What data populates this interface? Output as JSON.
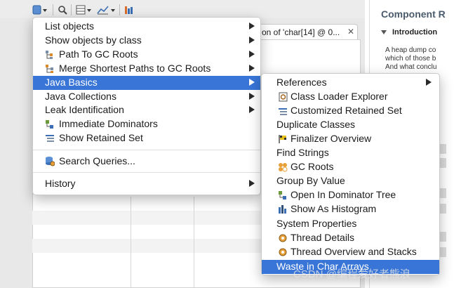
{
  "background": {
    "editor_tab_title": "on of 'char[14] @ 0...",
    "editor_tab_close": "✕",
    "right_panel": {
      "title": "Component R",
      "section_title": "Introduction",
      "text_lines": [
        "A heap dump co",
        "which of those b",
        "And what conclu"
      ]
    }
  },
  "main_menu": {
    "items": [
      {
        "label": "List objects",
        "has_submenu": true
      },
      {
        "label": "Show objects by class",
        "has_submenu": true
      },
      {
        "label": "Path To GC Roots",
        "icon": "path-to-gc-roots-icon",
        "has_submenu": true
      },
      {
        "label": "Merge Shortest Paths to GC Roots",
        "icon": "merge-paths-icon",
        "has_submenu": true
      },
      {
        "label": "Java Basics",
        "has_submenu": true,
        "selected": true
      },
      {
        "label": "Java Collections",
        "has_submenu": true
      },
      {
        "label": "Leak Identification",
        "has_submenu": true
      },
      {
        "label": "Immediate Dominators",
        "icon": "immediate-dominators-icon"
      },
      {
        "label": "Show Retained Set",
        "icon": "retained-set-icon"
      },
      {
        "label": "Search Queries...",
        "icon": "search-queries-icon"
      },
      {
        "label": "History",
        "has_submenu": true
      }
    ]
  },
  "submenu": {
    "items": [
      {
        "label": "References",
        "has_submenu": true
      },
      {
        "label": "Class Loader Explorer",
        "icon": "class-loader-icon"
      },
      {
        "label": "Customized Retained Set",
        "icon": "customized-retained-set-icon"
      },
      {
        "label": "Duplicate Classes"
      },
      {
        "label": "Finalizer Overview",
        "icon": "finalizer-icon"
      },
      {
        "label": "Find Strings"
      },
      {
        "label": "GC Roots",
        "icon": "gc-roots-icon"
      },
      {
        "label": "Group By Value"
      },
      {
        "label": "Open In Dominator Tree",
        "icon": "dominator-tree-icon"
      },
      {
        "label": "Show As Histogram",
        "icon": "histogram-icon"
      },
      {
        "label": "System Properties"
      },
      {
        "label": "Thread Details",
        "icon": "thread-details-icon"
      },
      {
        "label": "Thread Overview and Stacks",
        "icon": "thread-overview-icon"
      },
      {
        "label": "Waste in Char Arrays",
        "selected": true
      }
    ]
  },
  "watermark": "CSDN @编程爱好者熊浪",
  "colors": {
    "selection": "#3875d7",
    "panel_title": "#4a5b6c"
  }
}
